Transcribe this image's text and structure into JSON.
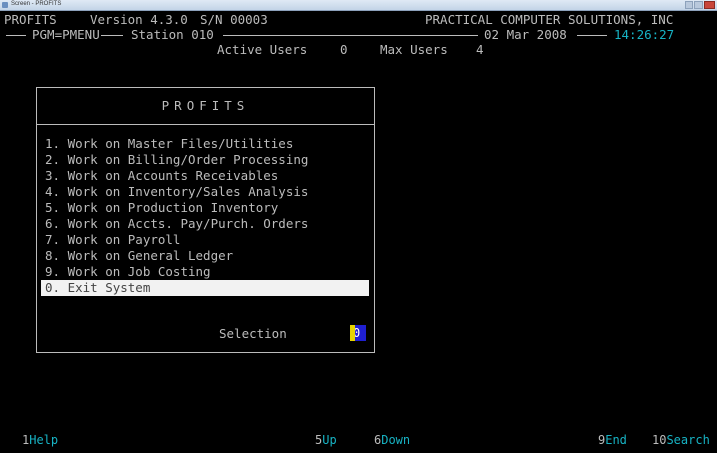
{
  "window": {
    "title": "Screen - PROFITS"
  },
  "header": {
    "app_name": "PROFITS",
    "version": "Version 4.3.0",
    "serial": "S/N 00003",
    "company": "PRACTICAL COMPUTER SOLUTIONS, INC",
    "program": "PGM=PMENU",
    "station": "Station 010",
    "date": "02 Mar 2008",
    "time": "14:26:27",
    "active_users_label": "Active Users",
    "active_users_value": "0",
    "max_users_label": "Max Users",
    "max_users_value": "4"
  },
  "menu": {
    "title": "PROFITS",
    "items": [
      {
        "label": "1. Work on Master Files/Utilities"
      },
      {
        "label": "2. Work on Billing/Order Processing"
      },
      {
        "label": "3. Work on Accounts Receivables"
      },
      {
        "label": "4. Work on Inventory/Sales Analysis"
      },
      {
        "label": "5. Work on Production Inventory"
      },
      {
        "label": "6. Work on Accts. Pay/Purch. Orders"
      },
      {
        "label": "7. Work on Payroll"
      },
      {
        "label": "8. Work on General Ledger"
      },
      {
        "label": "9. Work on Job Costing"
      },
      {
        "label": "0. Exit System",
        "selected": true
      }
    ],
    "selection_label": "Selection",
    "selection_value": "0"
  },
  "function_keys": [
    {
      "key": "1",
      "label": "Help"
    },
    {
      "key": "5",
      "label": "Up"
    },
    {
      "key": "6",
      "label": "Down"
    },
    {
      "key": "9",
      "label": "End"
    },
    {
      "key": "10",
      "label": "Search"
    }
  ],
  "colors": {
    "background": "#000000",
    "text": "#bcbcbc",
    "accent": "#17b3c4",
    "selection_field": "#1f1fd0",
    "cursor": "#e6d400"
  }
}
